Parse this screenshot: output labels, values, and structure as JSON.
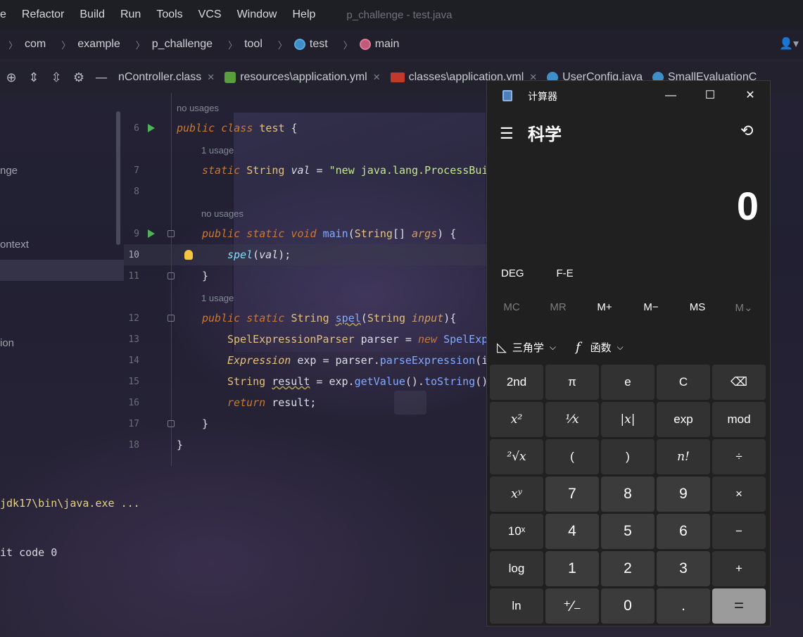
{
  "menubar": {
    "items": [
      "e",
      "Refactor",
      "Build",
      "Run",
      "Tools",
      "VCS",
      "Window",
      "Help"
    ],
    "window_title": "p_challenge - test.java"
  },
  "breadcrumbs": [
    "com",
    "example",
    "p_challenge",
    "tool",
    "test",
    "main"
  ],
  "tabs": [
    {
      "label": "nController.class"
    },
    {
      "label": "resources\\application.yml"
    },
    {
      "label": "classes\\application.yml"
    },
    {
      "label": "UserConfig.java"
    },
    {
      "label": "SmallEvaluationC"
    }
  ],
  "left_panel": {
    "items": [
      "nge",
      "ontext",
      "ion"
    ]
  },
  "editor": {
    "hints": {
      "h1": "no usages",
      "h2": "1 usage",
      "h3": "no usages",
      "h4": "1 usage"
    },
    "lines": {
      "l6": "6",
      "l7": "7",
      "l8": "8",
      "l9": "9",
      "l10": "10",
      "l11": "11",
      "l12": "12",
      "l13": "13",
      "l14": "14",
      "l15": "15",
      "l16": "16",
      "l17": "17",
      "l18": "18"
    },
    "code": {
      "c6_kw": "public class ",
      "c6_name": "test",
      "c6_brace": " {",
      "c7_kw": "static ",
      "c7_type": "String ",
      "c7_var": "val",
      "c7_eq": " = ",
      "c7_str": "\"new java.lang.ProcessBui",
      "c9_kw": "public static void ",
      "c9_fn": "main",
      "c9_p1": "(",
      "c9_type": "String",
      "c9_p2": "[] ",
      "c9_par": "args",
      "c9_p3": ") {",
      "c10_fn": "spel",
      "c10_p1": "(",
      "c10_var": "val",
      "c10_p2": ");",
      "c11": "}",
      "c12_kw": "public static ",
      "c12_type": "String ",
      "c12_fn": "spel",
      "c12_p1": "(",
      "c12_type2": "String ",
      "c12_par": "input",
      "c12_p2": "){",
      "c13_type": "SpelExpressionParser ",
      "c13_rest": "parser = ",
      "c13_kw": "new ",
      "c13_type2": "SpelExp",
      "c14_type": "Expression ",
      "c14_rest": "exp = parser.",
      "c14_fn": "parseExpression",
      "c14_p": "(i",
      "c15_type": "String ",
      "c15_var": "result",
      "c15_rest": " = exp.",
      "c15_fn1": "getValue",
      "c15_mid": "().",
      "c15_fn2": "toString",
      "c15_end": "()",
      "c16_kw": "return ",
      "c16_rest": "result;",
      "c17": "}",
      "c18": "}"
    }
  },
  "console": {
    "line1": "jdk17\\bin\\java.exe ...",
    "line2": "it code 0"
  },
  "calculator": {
    "title": "计算器",
    "mode": "科学",
    "display": "0",
    "angle_mode": "DEG",
    "fe_label": "F-E",
    "memory": [
      "MC",
      "MR",
      "M+",
      "M−",
      "MS",
      "M⌄"
    ],
    "trig_label": "三角学",
    "func_label": "函数",
    "keys": [
      "2nd",
      "π",
      "e",
      "C",
      "⌫",
      "x²",
      "¹⁄x",
      "|x|",
      "exp",
      "mod",
      "²√x",
      "(",
      ")",
      "n!",
      "÷",
      "xʸ",
      "7",
      "8",
      "9",
      "×",
      "10ˣ",
      "4",
      "5",
      "6",
      "−",
      "log",
      "1",
      "2",
      "3",
      "+",
      "ln",
      "⁺⁄₋",
      "0",
      ".",
      "="
    ]
  }
}
